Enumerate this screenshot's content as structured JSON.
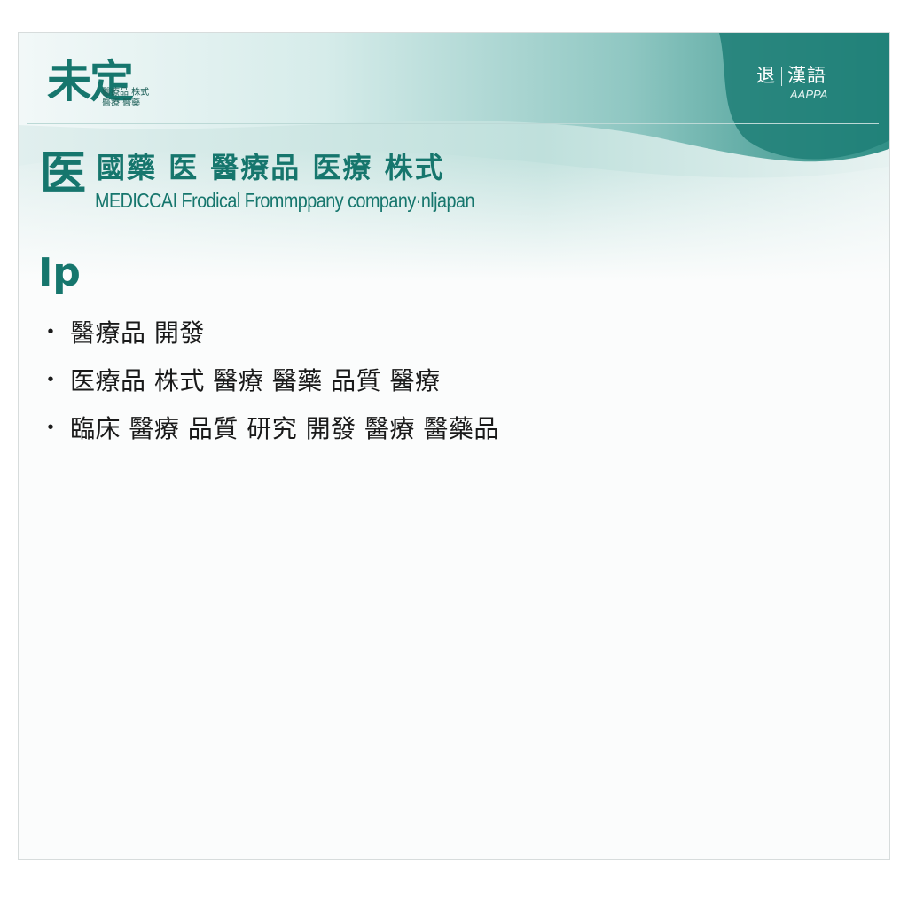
{
  "header": {
    "logo_text": "未定",
    "logo_sub_line1": "醫療品 株式",
    "logo_sub_line2": "醫療 醫藥",
    "corner_jp_left": "退",
    "corner_jp_right": "漢語",
    "corner_en": "AAPPA"
  },
  "company": {
    "icon": "医",
    "name_jp": "國藥 医 醫療品 医療 株式",
    "name_en": "MEDICCAI Frodical Frommppany company·nljapan"
  },
  "content": {
    "title": "Ip",
    "bullets": [
      "醫療品 開發",
      "医療品 株式 醫療 醫藥 品質 醫療",
      "臨床 醫療 品質 研究 開發 醫療 醫藥品"
    ],
    "bullet_symbol": "•"
  },
  "colors": {
    "brand": "#16766d",
    "accent_light": "#9fd0cb",
    "text": "#1a1a1a"
  }
}
